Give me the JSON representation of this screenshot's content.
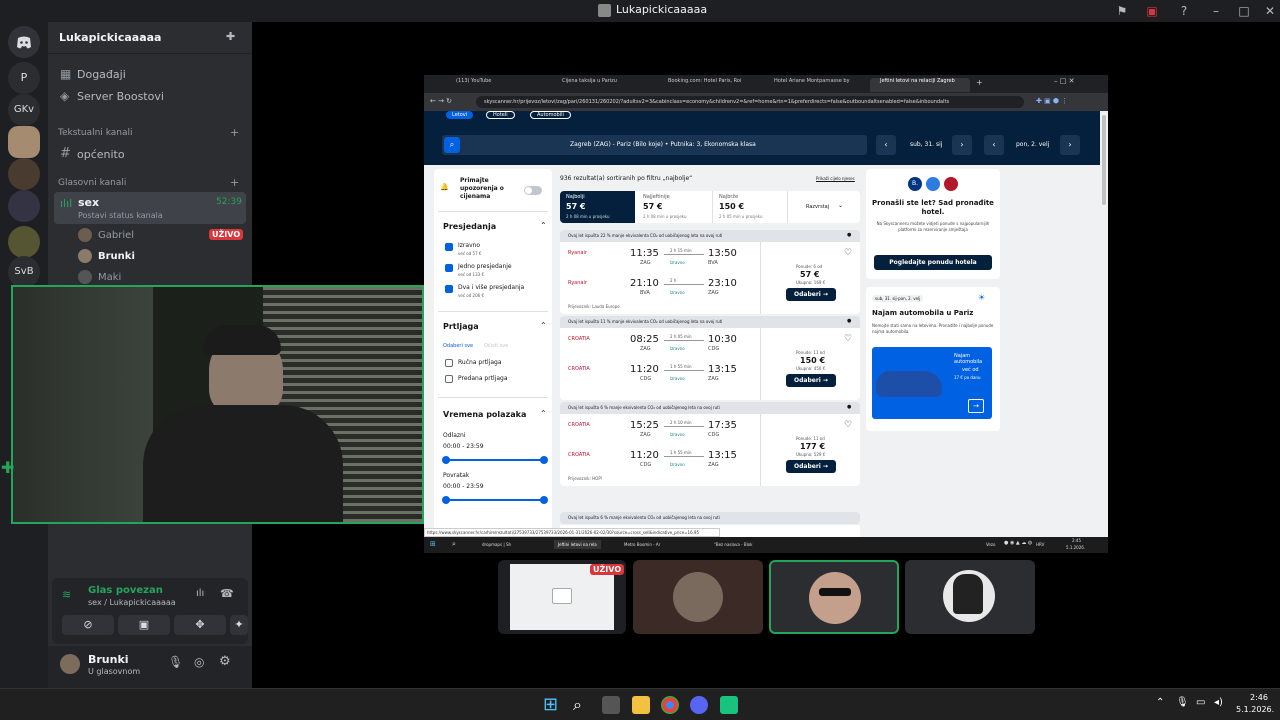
{
  "window": {
    "title": "Lukapickicaaaaa"
  },
  "rail": {
    "servers": [
      "P",
      "GKv",
      "SvB"
    ]
  },
  "sidebar": {
    "server_name": "Lukapickicaaaaa",
    "events_label": "Događaji",
    "boost_label": "Server Boostovi",
    "text_category": "Tekstualni kanali",
    "text_channel": "općenito",
    "voice_category": "Glasovni kanali",
    "voice_channel": "sex",
    "voice_timer": "52:39",
    "set_status": "Postavi status kanala",
    "members": [
      {
        "name": "Gabriel",
        "badge": "UŽIVO"
      },
      {
        "name": "Brunki",
        "badge": ""
      },
      {
        "name": "Maki",
        "badge": ""
      }
    ],
    "voice_connected": "Glas povezan",
    "voice_location": "sex / Lukapickicaaaaa",
    "user_name": "Brunki",
    "user_status": "U glasovnom"
  },
  "browser": {
    "tabs": [
      "(113) YouTube",
      "Cijena taksija u Parizu",
      "Booking.com: Hotel Paris, Roi",
      "Hotel Ariane Montparnasse by",
      "Jeftini letovi na relaciji Zagreb"
    ],
    "url": "skyscanner.hr/prijevoz/letovi/zag/pari/260131/260202/?adultsv2=3&cabinclass=economy&childrenv2=&ref=home&rtn=1&preferdirects=false&outboundaltsenabled=false&inboundalts",
    "nav_tabs": [
      "Letovi",
      "Hoteli",
      "Automobili"
    ],
    "search_summary": "Zagreb (ZAG) - Pariz (Bilo koje) • Putnika: 3, Ekonomska klasa",
    "depart_date": "sub, 31. sij",
    "return_date": "pon, 2. velj",
    "price_alert": "Primajte upozorenja o cijenama",
    "stops_title": "Presjedanja",
    "stops": [
      {
        "label": "Izravno",
        "sub": "već od 57 €"
      },
      {
        "label": "Jedno presjedanje",
        "sub": "već od 133 €"
      },
      {
        "label": "Dva i više presjedanja",
        "sub": "već od 206 €"
      }
    ],
    "baggage_title": "Prtljaga",
    "select_all": "Odaberi sve",
    "clear_all": "Očisti sve",
    "baggage": [
      "Ručna prtljaga",
      "Predana prtljaga"
    ],
    "times_title": "Vremena polazaka",
    "outbound_label": "Odlazni",
    "outbound_range": "00:00 - 23:59",
    "return_label": "Povratak",
    "return_range": "00:00 - 23:59",
    "results_count": "936 rezultat(a) sortiranih po filtru „najbolje“",
    "hidden_fees": "Prikaži cijelo njesec",
    "sort": [
      {
        "label": "Najbolji",
        "price": "57 €",
        "sub": "2 h 08 min u prosjeku"
      },
      {
        "label": "Najjeftinije",
        "price": "57 €",
        "sub": "2 h 08 min u prosjeku"
      },
      {
        "label": "Najbrže",
        "price": "150 €",
        "sub": "2 h 05 min u prosjeku"
      }
    ],
    "sort_menu": "Razvrstaj",
    "results": [
      {
        "eco": "Ovaj let ispušta 22 % manje ekvivalenta CO₂ od uobičajenog leta na ovoj ruti",
        "legs": [
          {
            "airline": "Ryanair",
            "dep": "11:35",
            "dep_ap": "ZAG",
            "dur": "2 h 15 min",
            "stop": "Izravno",
            "arr": "13:50",
            "arr_ap": "BVA"
          },
          {
            "airline": "Ryanair",
            "dep": "21:10",
            "dep_ap": "BVA",
            "dur": "2 h",
            "stop": "Izravno",
            "arr": "23:10",
            "arr_ap": "ZAG"
          }
        ],
        "operator": "Prijevoznik: Lauda Europe",
        "offers": "Ponude: 6 od",
        "price": "57 €",
        "total": "Ukupno: 169 €"
      },
      {
        "eco": "Ovaj let ispušta 11 % manje ekvivalenta CO₂ od uobičajenog leta na ovoj ruti",
        "legs": [
          {
            "airline": "CROATIA",
            "dep": "08:25",
            "dep_ap": "ZAG",
            "dur": "2 h 05 min",
            "stop": "Izravno",
            "arr": "10:30",
            "arr_ap": "CDG"
          },
          {
            "airline": "CROATIA",
            "dep": "11:20",
            "dep_ap": "CDG",
            "dur": "1 h 55 min",
            "stop": "Izravno",
            "arr": "13:15",
            "arr_ap": "ZAG"
          }
        ],
        "operator": "",
        "offers": "Ponude: 11 od",
        "price": "150 €",
        "total": "Ukupno: 450 €"
      },
      {
        "eco": "Ovaj let ispušta 6 % manje ekvivalenta CO₂ od uobičajenog leta na ovoj ruti",
        "legs": [
          {
            "airline": "CROATIA",
            "dep": "15:25",
            "dep_ap": "ZAG",
            "dur": "2 h 10 min",
            "stop": "Izravno",
            "arr": "17:35",
            "arr_ap": "CDG"
          },
          {
            "airline": "CROATIA",
            "dep": "11:20",
            "dep_ap": "CDG",
            "dur": "1 h 55 min",
            "stop": "Izravno",
            "arr": "13:15",
            "arr_ap": "ZAG"
          }
        ],
        "operator": "Prijevoznik: HOP!",
        "offers": "Ponude: 11 od",
        "price": "177 €",
        "total": "Ukupno: 529 €"
      }
    ],
    "select_btn": "Odaberi →",
    "eco4": "Ovaj let ispušta 6 % manje ekvivalenta CO₂ od uobičajenog leta na ovoj ruti",
    "hotel_promo": {
      "title": "Pronašli ste let? Sad pronađite hotel.",
      "text": "Na Skyscanneru možete vidjeti ponude s najpopularnijih platformi za rezerviranje smještaja",
      "btn": "Pogledajte ponudu hotela"
    },
    "car_promo": {
      "dates": "sub, 31. sij-pon, 2. velj",
      "title": "Najam automobila u Pariz",
      "text": "Nemojte stati samo na letovima. Pronađite i najbolje ponude najma automobila.",
      "img_title": "Najam automobila",
      "img_sub": "već od",
      "img_price": "17 € po danu"
    },
    "status_url": "https://www.skyscanner.hr/carhire/rezultati/27539733/27539733/2026-01-31/2026-02-02/30?source=cross_sell&indicative_price=16.95"
  },
  "inner_taskbar": {
    "items": [
      "dropmaps | Sh",
      "Jeftini letovi na rela",
      "Metro Boomin - Ar",
      "\"Bez naslova - Blok"
    ],
    "tray": "Vezo",
    "lang": "HRV",
    "time": "2:45",
    "date": "5.1.2026."
  },
  "tiles": {
    "live_badge": "UŽIVO"
  },
  "taskbar": {
    "time": "2:46",
    "date": "5.1.2026."
  },
  "colors": {
    "discord_green": "#23a55a",
    "live_red": "#da373c",
    "sky_navy": "#05203c",
    "sky_blue": "#0062e3"
  }
}
